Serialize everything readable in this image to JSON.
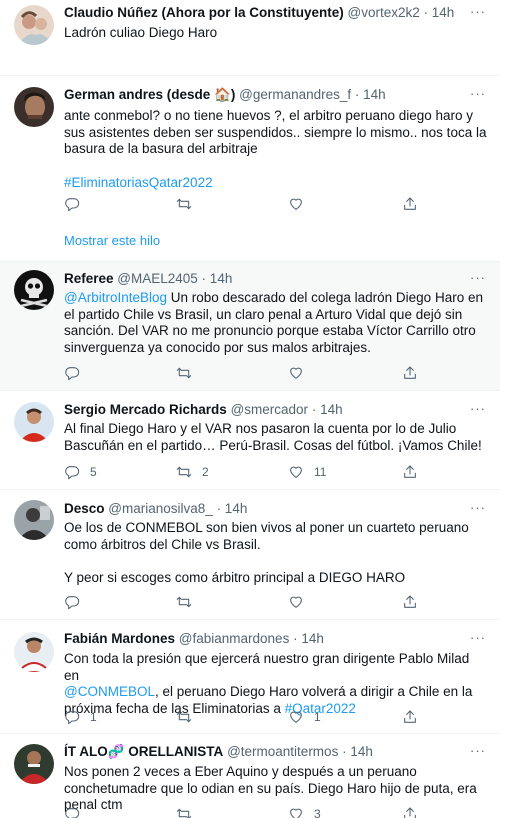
{
  "colors": {
    "link": "#1d9bf0",
    "meta": "#536471",
    "divider": "#eff3f4",
    "highlight": "#f7f9f9"
  },
  "more_glyph": "···",
  "tweets": [
    {
      "name": "Claudio Núñez (Ahora por la Constituyente)",
      "handle": "@vortex2k2",
      "time": "· 14h",
      "text": "Ladrón culiao Diego Haro"
    },
    {
      "name": "German andres (desde 🏠)",
      "handle": "@germanandres_f",
      "time": "· 14h",
      "text": "ante conmebol? o no tiene huevos ?, el arbitro peruano diego haro y sus asistentes deben ser suspendidos.. siempre lo mismo.. nos toca la basura de la basura del arbitraje",
      "hashtag": "#EliminatoriasQatar2022",
      "show_thread": "Mostrar este hilo"
    },
    {
      "name": "Referee",
      "handle": "@MAEL2405",
      "time": "· 14h",
      "mention": "@ArbitroInteBlog",
      "text": " Un robo descarado del colega ladrón Diego Haro en el partido Chile vs Brasil, un claro penal a Arturo Vidal que dejó sin sanción. Del VAR no me pronuncio porque estaba Víctor Carrillo otro sinverguenza ya conocido por sus malos arbitrajes."
    },
    {
      "name": "Sergio Mercado Richards",
      "handle": "@smercador",
      "time": "· 14h",
      "text": "Al final Diego Haro y el VAR nos pasaron la cuenta por lo de Julio Bascuñán en el partido… Perú-Brasil. Cosas del fútbol. ¡Vamos Chile!",
      "replies": "5",
      "retweets": "2",
      "likes": "11"
    },
    {
      "name": "Desco",
      "handle": "@marianosilva8_",
      "time": "· 14h",
      "text": "Oe los de CONMEBOL son bien vivos al poner un cuarteto peruano como árbitros del Chile vs Brasil.\n\nY peor si escoges como árbitro principal a DIEGO HARO"
    },
    {
      "name": "Fabián Mardones",
      "handle": "@fabianmardones",
      "time": "· 14h",
      "text_a": "Con toda la presión que ejercerá nuestro gran dirigente Pablo Milad en",
      "mention": "@CONMEBOL",
      "text_b": ", el peruano Diego Haro volverá a dirigir a Chile en la próxima fecha de las Eliminatorias a ",
      "hashtag": "#Qatar2022",
      "replies": "1",
      "likes": "1"
    },
    {
      "name": "ÍT ALO🧬 ORELLANISTA",
      "handle": "@termoantitermos",
      "time": "· 14h",
      "text": "Nos ponen 2 veces a Eber Aquino y después a un peruano conchetumadre que lo odian en su país. Diego Haro hijo de puta, era penal ctm",
      "likes": "3"
    }
  ]
}
